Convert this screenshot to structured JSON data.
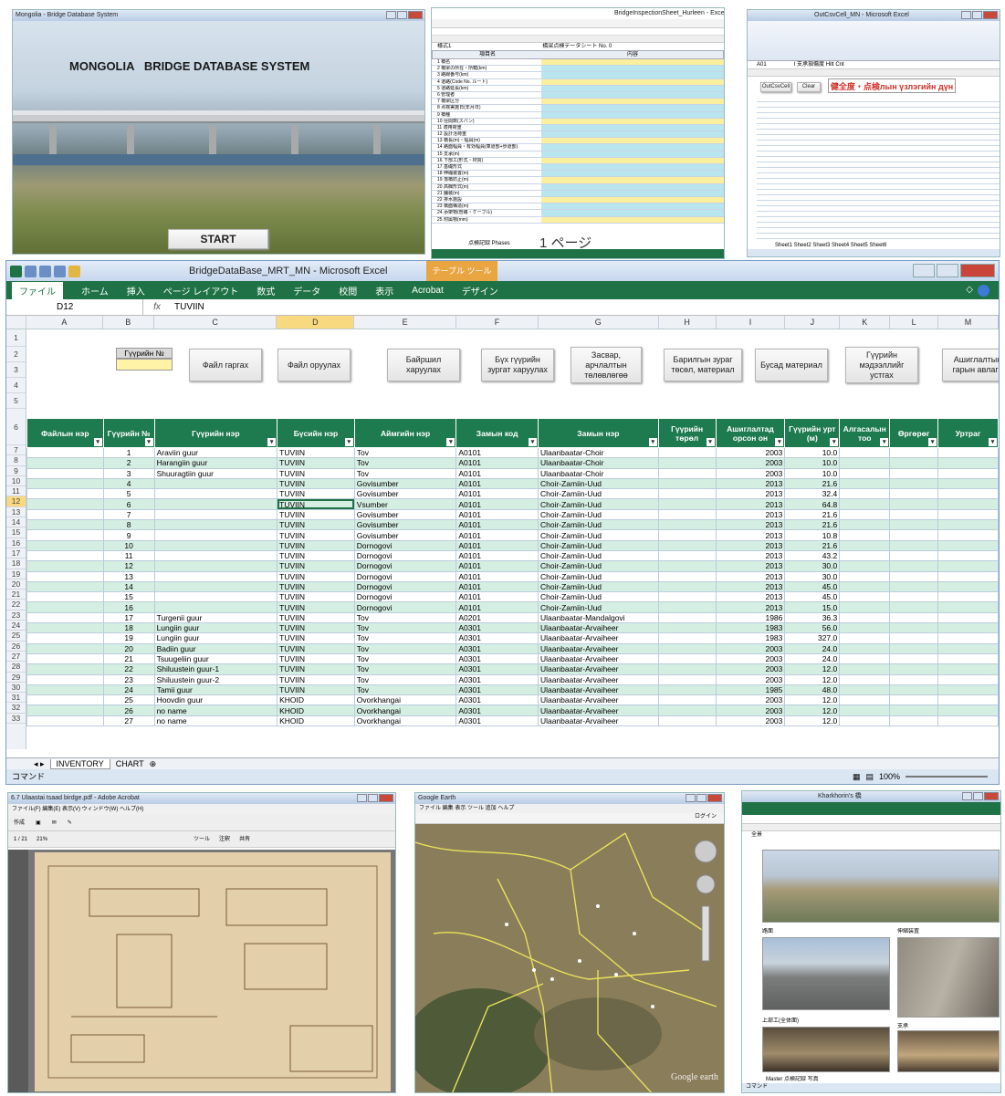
{
  "p1": {
    "title": "Mongolia - Bridge Database System",
    "heading": "MONGOLIA   BRIDGE DATABASE SYSTEM",
    "start": "START"
  },
  "p2": {
    "title": "BridgeInspectionSheet_Hurleen - Excel",
    "sheet_title": "橋梁点検データシート No. 0",
    "cell_a1": "様式1",
    "col_name": "項目名",
    "col_data": "内容",
    "page_mark": "1 ページ",
    "tabs": "点検記録  Phases",
    "rows": [
      "1 橋名",
      "2 橋梁の所在・所轄(km)",
      "3 路線番号(km)",
      "4 道路(Code No. ルート)",
      "5 道路延長(km)",
      "6 管理者",
      "7 橋梁区分",
      "8 点検実施日(年月日)",
      "9 橋種",
      "10 径間数(スパン)",
      "11 適用荷重",
      "12 設計活荷重",
      "13 橋長(m)・幅員(m)",
      "14 路面幅員・有効幅員(車道部+歩道部)",
      "15 支承(m)",
      "16 下部工(形式・材質)",
      "17 基礎形式",
      "18 伸縮装置(m)",
      "19 落橋防止(m)",
      "20 高欄形式(m)",
      "21 舗装(m)",
      "22 排水施設",
      "23 橋面構造(m)",
      "24 添架物(管路・ケーブル)",
      "25 附属物(mm)"
    ]
  },
  "p3": {
    "title": "OutCsvCell_MN - Microsoft Excel",
    "formula": "A01",
    "fx": "I 支承損傷度 Hitt Cnt",
    "banner": "健全度・点検лын үзлэгийн дүн",
    "btn1": "OutCsvCell",
    "btn2": "Clear",
    "tabs": "Sheet1  Sheet2  Sheet3  Sheet4  Sheet5  Sheet6"
  },
  "main": {
    "window_title": "BridgeDataBase_MRT_MN - Microsoft Excel",
    "context_tab": "テーブル ツール",
    "ribbon_tabs": [
      "ファイル",
      "ホーム",
      "挿入",
      "ページ レイアウト",
      "数式",
      "データ",
      "校閲",
      "表示",
      "Acrobat",
      "デザイン"
    ],
    "name_box": "D12",
    "fx": "fx",
    "formula": "TUVIIN",
    "columns": [
      "A",
      "B",
      "C",
      "D",
      "E",
      "F",
      "G",
      "H",
      "I",
      "J",
      "K",
      "L",
      "M"
    ],
    "row_label_bridge_no": "Гүүрийн №",
    "buttons": {
      "file_out": "Файл гаргах",
      "file_in": "Файл оруулах",
      "location": "Байршил\nхаруулах",
      "all_photos": "Бүх гүүрийн\nзургат харуулах",
      "repair": "Засвар,\nарчлалтын\nтөлөвлөгөө",
      "drawing": "Барилгын зураг\nтөсөл, материал",
      "other": "Бусад материал",
      "entry": "Гүүрийн\nмэдээллийг\nустгах",
      "inspect": "Ашиглалтын\nгарын авлага"
    },
    "headers": [
      "Файлын нэр",
      "Гүүрийн №",
      "Гүүрийн нэр",
      "Бүсийн нэр",
      "Аймгийн нэр",
      "Замын код",
      "Замын нэр",
      "Гүүрийн төрөл",
      "Ашиглалтад орсон он",
      "Гүүрийн урт (м)",
      "Алгасалын тоо",
      "Өргөрөг",
      "Уртраг"
    ],
    "rows": [
      [
        "",
        "1",
        "Araviin guur",
        "TUVIIN",
        "Tov",
        "A0101",
        "Ulaanbaatar-Choir",
        "",
        "2003",
        "10.0"
      ],
      [
        "",
        "2",
        "Harangiin guur",
        "TUVIIN",
        "Tov",
        "A0101",
        "Ulaanbaatar-Choir",
        "",
        "2003",
        "10.0"
      ],
      [
        "",
        "3",
        "Shuuragtiin guur",
        "TUVIIN",
        "Tov",
        "A0101",
        "Ulaanbaatar-Choir",
        "",
        "2003",
        "10.0"
      ],
      [
        "",
        "4",
        "",
        "TUVIIN",
        "Govisumber",
        "A0101",
        "Choir-Zamiin-Uud",
        "",
        "2013",
        "21.6"
      ],
      [
        "",
        "5",
        "",
        "TUVIIN",
        "Govisumber",
        "A0101",
        "Choir-Zamiin-Uud",
        "",
        "2013",
        "32.4"
      ],
      [
        "",
        "6",
        "",
        "TUVIIN",
        "Vsumber",
        "A0101",
        "Choir-Zamiin-Uud",
        "",
        "2013",
        "64.8"
      ],
      [
        "",
        "7",
        "",
        "TUVIIN",
        "Govisumber",
        "A0101",
        "Choir-Zamiin-Uud",
        "",
        "2013",
        "21.6"
      ],
      [
        "",
        "8",
        "",
        "TUVIIN",
        "Govisumber",
        "A0101",
        "Choir-Zamiin-Uud",
        "",
        "2013",
        "21.6"
      ],
      [
        "",
        "9",
        "",
        "TUVIIN",
        "Govisumber",
        "A0101",
        "Choir-Zamiin-Uud",
        "",
        "2013",
        "10.8"
      ],
      [
        "",
        "10",
        "",
        "TUVIIN",
        "Dornogovi",
        "A0101",
        "Choir-Zamiin-Uud",
        "",
        "2013",
        "21.6"
      ],
      [
        "",
        "11",
        "",
        "TUVIIN",
        "Dornogovi",
        "A0101",
        "Choir-Zamiin-Uud",
        "",
        "2013",
        "43.2"
      ],
      [
        "",
        "12",
        "",
        "TUVIIN",
        "Dornogovi",
        "A0101",
        "Choir-Zamiin-Uud",
        "",
        "2013",
        "30.0"
      ],
      [
        "",
        "13",
        "",
        "TUVIIN",
        "Dornogovi",
        "A0101",
        "Choir-Zamiin-Uud",
        "",
        "2013",
        "30.0"
      ],
      [
        "",
        "14",
        "",
        "TUVIIN",
        "Dornogovi",
        "A0101",
        "Choir-Zamiin-Uud",
        "",
        "2013",
        "45.0"
      ],
      [
        "",
        "15",
        "",
        "TUVIIN",
        "Dornogovi",
        "A0101",
        "Choir-Zamiin-Uud",
        "",
        "2013",
        "45.0"
      ],
      [
        "",
        "16",
        "",
        "TUVIIN",
        "Dornogovi",
        "A0101",
        "Choir-Zamiin-Uud",
        "",
        "2013",
        "15.0"
      ],
      [
        "",
        "17",
        "Turgenii guur",
        "TUVIIN",
        "Tov",
        "A0201",
        "Ulaanbaatar-Mandalgovi",
        "",
        "1986",
        "36.3"
      ],
      [
        "",
        "18",
        "Lungiin guur",
        "TUVIIN",
        "Tov",
        "A0301",
        "Ulaanbaatar-Arvaiheer",
        "",
        "1983",
        "56.0"
      ],
      [
        "",
        "19",
        "Lungiin guur",
        "TUVIIN",
        "Tov",
        "A0301",
        "Ulaanbaatar-Arvaiheer",
        "",
        "1983",
        "327.0"
      ],
      [
        "",
        "20",
        "Badiin guur",
        "TUVIIN",
        "Tov",
        "A0301",
        "Ulaanbaatar-Arvaiheer",
        "",
        "2003",
        "24.0"
      ],
      [
        "",
        "21",
        "Tsuugeliin guur",
        "TUVIIN",
        "Tov",
        "A0301",
        "Ulaanbaatar-Arvaiheer",
        "",
        "2003",
        "24.0"
      ],
      [
        "",
        "22",
        "Shiluustein guur-1",
        "TUVIIN",
        "Tov",
        "A0301",
        "Ulaanbaatar-Arvaiheer",
        "",
        "2003",
        "12.0"
      ],
      [
        "",
        "23",
        "Shiluustein guur-2",
        "TUVIIN",
        "Tov",
        "A0301",
        "Ulaanbaatar-Arvaiheer",
        "",
        "2003",
        "12.0"
      ],
      [
        "",
        "24",
        "Tamii guur",
        "TUVIIN",
        "Tov",
        "A0301",
        "Ulaanbaatar-Arvaiheer",
        "",
        "1985",
        "48.0"
      ],
      [
        "",
        "25",
        "Hoovdin guur",
        "KHOID",
        "Ovorkhangai",
        "A0301",
        "Ulaanbaatar-Arvaiheer",
        "",
        "2003",
        "12.0"
      ],
      [
        "",
        "26",
        "no name",
        "KHOID",
        "Ovorkhangai",
        "A0301",
        "Ulaanbaatar-Arvaiheer",
        "",
        "2003",
        "12.0"
      ],
      [
        "",
        "27",
        "no name",
        "KHOID",
        "Ovorkhangai",
        "A0301",
        "Ulaanbaatar-Arvaiheer",
        "",
        "2003",
        "12.0"
      ]
    ],
    "sheet_tabs": [
      "INVENTORY",
      "CHART"
    ],
    "status": "コマンド",
    "zoom": "100%"
  },
  "p4": {
    "title": "6.7 Ulaastai tsaad birdge.pdf - Adobe Acrobat",
    "menu": "ファイル(F)  編集(E)  表示(V)  ウィンドウ(W)  ヘルプ(H)",
    "create": "作成",
    "page": "1 / 21",
    "zoom": "21%",
    "tools": "ツール",
    "comment": "注釈",
    "share": "共有"
  },
  "p5": {
    "title": "Google Earth",
    "menu": "ファイル  編集  表示  ツール  追加  ヘルプ",
    "login": "ログイン",
    "brand": "Google earth"
  },
  "p6": {
    "title": "16 Kharkhorin s - Microsoft Excel",
    "cell": "Kharkhorin's 橋",
    "status": "コマンド",
    "tabs": "Master  点検記録  写真",
    "label_top": "全景",
    "label_mid": "路面",
    "label_right": "伸縮装置",
    "label_bl": "上部工(全体面)",
    "label_br": "支承"
  }
}
